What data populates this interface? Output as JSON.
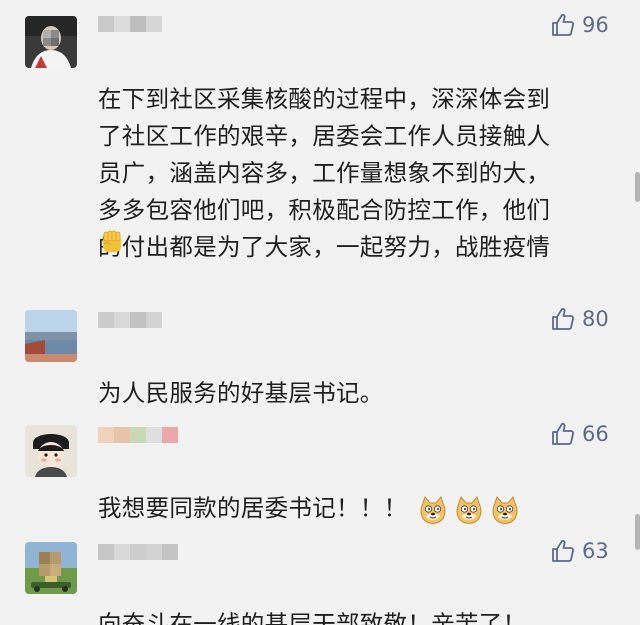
{
  "comments": [
    {
      "likes": "96",
      "text": "在下到社区采集核酸的过程中，深深体会到\n了社区工作的艰辛，居委会工作人员接触人\n员广，涵盖内容多，工作量想象不到的大，\n多多包容他们吧，积极配合防控工作，他们\n的付出都是为了大家，一起努力，战胜疫情",
      "emoji": "raised-fist"
    },
    {
      "likes": "80",
      "text": "为人民服务的好基层书记。"
    },
    {
      "likes": "66",
      "text": "我想要同款的居委书记！！！",
      "emoji": "doge-x3"
    },
    {
      "likes": "63",
      "text": "向奋斗在一线的基层干部致敬！辛苦了！"
    }
  ],
  "icons": {
    "like": "thumbs-up-icon"
  },
  "colors": {
    "background": "#f2f2f2",
    "text": "#1f1f1f",
    "like": "#5b6a8c"
  }
}
